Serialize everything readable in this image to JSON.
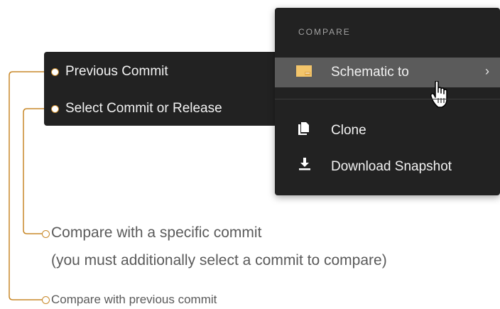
{
  "menu": {
    "section_header": "COMPARE",
    "items": [
      {
        "label": "Schematic to",
        "icon": "schematic-icon",
        "active": true,
        "has_submenu": true
      },
      {
        "label": "Clone",
        "icon": "clone-icon",
        "active": false
      },
      {
        "label": "Download Snapshot",
        "icon": "download-icon",
        "active": false
      }
    ],
    "chevron": "›"
  },
  "submenu": {
    "items": [
      {
        "label": "Previous Commit"
      },
      {
        "label": "Select Commit or Release"
      }
    ]
  },
  "callouts": {
    "specific_commit_line1": "Compare with a specific commit",
    "specific_commit_line2": "(you must additionally select a commit to compare)",
    "previous_commit": "Compare with previous commit"
  },
  "colors": {
    "menu_bg": "#222222",
    "active_bg": "#5b5b5b",
    "accent": "#c8892a",
    "schematic_icon": "#f3c56b"
  }
}
